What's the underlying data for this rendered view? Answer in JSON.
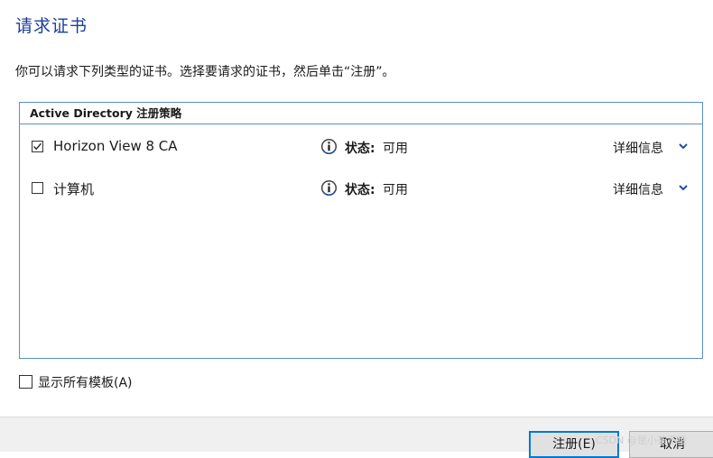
{
  "header": {
    "title": "请求证书",
    "instruction": "你可以请求下列类型的证书。选择要请求的证书，然后单击“注册”。"
  },
  "policy": {
    "header": "Active Directory 注册策略",
    "items": [
      {
        "name": "Horizon View 8 CA",
        "checked": true,
        "status_label": "状态:",
        "status_value": "可用",
        "details_label": "详细信息"
      },
      {
        "name": "计算机",
        "checked": false,
        "status_label": "状态:",
        "status_value": "可用",
        "details_label": "详细信息"
      }
    ]
  },
  "show_all": {
    "label": "显示所有模板(A)",
    "checked": false
  },
  "buttons": {
    "enroll_label": "注册(E)",
    "cancel_label": "取消"
  },
  "watermark": "CSDN @是小茶不哦",
  "colors": {
    "title": "#1c3f9c",
    "panel_border": "#5b8fc7",
    "accent": "#0078d7",
    "chevron": "#1f4fa3"
  }
}
